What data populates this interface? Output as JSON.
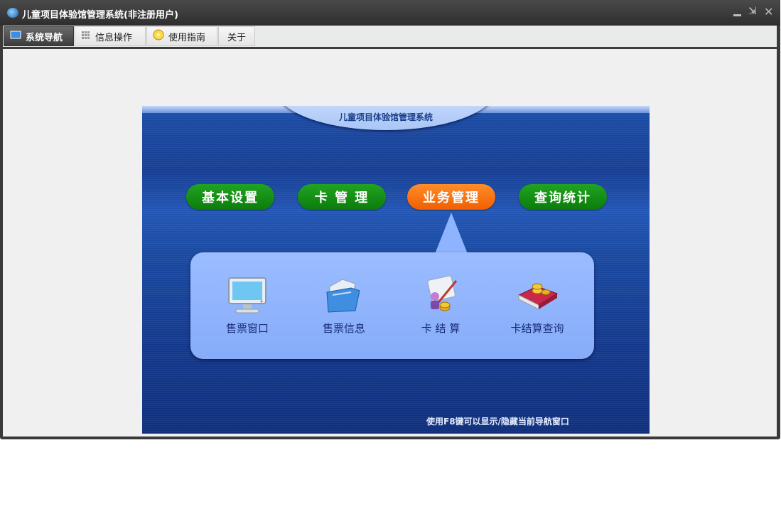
{
  "window": {
    "title": "儿童项目体验馆管理系统(非注册用户)",
    "controls": [
      "minimize-icon",
      "restore-icon",
      "close-icon"
    ]
  },
  "tabs": [
    {
      "label": "系统导航",
      "icon": "monitor-icon",
      "active": true
    },
    {
      "label": "信息操作",
      "icon": "grid-icon",
      "active": false
    },
    {
      "label": "使用指南",
      "icon": "help-icon",
      "active": false
    },
    {
      "label": "关于",
      "icon": "",
      "active": false
    }
  ],
  "banner": {
    "title": "儿童项目体验馆管理系统",
    "hint": "使用F8键可以显示/隐藏当前导航窗口"
  },
  "modules": [
    {
      "label": "基本设置",
      "active": false
    },
    {
      "label": "卡 管 理",
      "active": false
    },
    {
      "label": "业务管理",
      "active": true
    },
    {
      "label": "查询统计",
      "active": false
    }
  ],
  "submenu": [
    {
      "label": "售票窗口",
      "icon": "monitor-icon"
    },
    {
      "label": "售票信息",
      "icon": "folder-icon"
    },
    {
      "label": "卡 结 算",
      "icon": "settlement-icon"
    },
    {
      "label": "卡结算查询",
      "icon": "book-coins-icon"
    }
  ],
  "colors": {
    "accent_active": "#f15f00",
    "module_green": "#0c7c0c",
    "banner_blue": "#1a4aa1",
    "popup_blue": "#8fb4ff"
  }
}
